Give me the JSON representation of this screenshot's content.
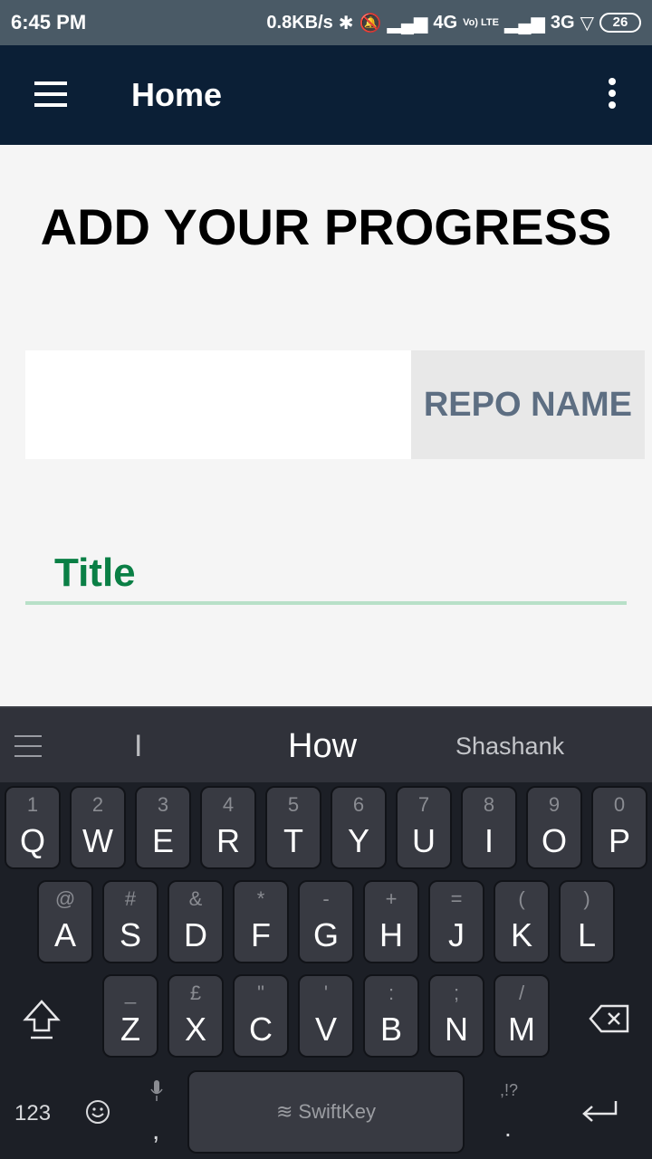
{
  "status_bar": {
    "time": "6:45 PM",
    "speed": "0.8KB/s",
    "network1": "4G",
    "volte": "Vo) LTE",
    "network2": "3G",
    "battery": "26"
  },
  "app_bar": {
    "title": "Home",
    "menu_icon": "hamburger-menu-icon",
    "overflow_icon": "more-vert-icon"
  },
  "main": {
    "heading": "ADD YOUR PROGRESS",
    "repo_input_value": "",
    "repo_button_label": "REPO NAME",
    "title_label": "Title"
  },
  "keyboard": {
    "suggestions": [
      "I",
      "How",
      "Shashank"
    ],
    "row1": [
      {
        "hint": "1",
        "key": "Q"
      },
      {
        "hint": "2",
        "key": "W"
      },
      {
        "hint": "3",
        "key": "E"
      },
      {
        "hint": "4",
        "key": "R"
      },
      {
        "hint": "5",
        "key": "T"
      },
      {
        "hint": "6",
        "key": "Y"
      },
      {
        "hint": "7",
        "key": "U"
      },
      {
        "hint": "8",
        "key": "I"
      },
      {
        "hint": "9",
        "key": "O"
      },
      {
        "hint": "0",
        "key": "P"
      }
    ],
    "row2": [
      {
        "hint": "@",
        "key": "A"
      },
      {
        "hint": "#",
        "key": "S"
      },
      {
        "hint": "&",
        "key": "D"
      },
      {
        "hint": "*",
        "key": "F"
      },
      {
        "hint": "-",
        "key": "G"
      },
      {
        "hint": "+",
        "key": "H"
      },
      {
        "hint": "=",
        "key": "J"
      },
      {
        "hint": "(",
        "key": "K"
      },
      {
        "hint": ")",
        "key": "L"
      }
    ],
    "row3": [
      {
        "hint": "_",
        "key": "Z"
      },
      {
        "hint": "£",
        "key": "X"
      },
      {
        "hint": "\"",
        "key": "C"
      },
      {
        "hint": "'",
        "key": "V"
      },
      {
        "hint": ":",
        "key": "B"
      },
      {
        "hint": ";",
        "key": "N"
      },
      {
        "hint": "/",
        "key": "M"
      }
    ],
    "numbers_label": "123",
    "comma": ",",
    "space_brand": "SwiftKey",
    "punct_hint": ",!?",
    "period": "."
  },
  "colors": {
    "app_bar": "#0b1f36",
    "accent_green": "#0a7f45",
    "repo_text": "#5d6e82",
    "keyboard_bg": "#1c1f26"
  }
}
